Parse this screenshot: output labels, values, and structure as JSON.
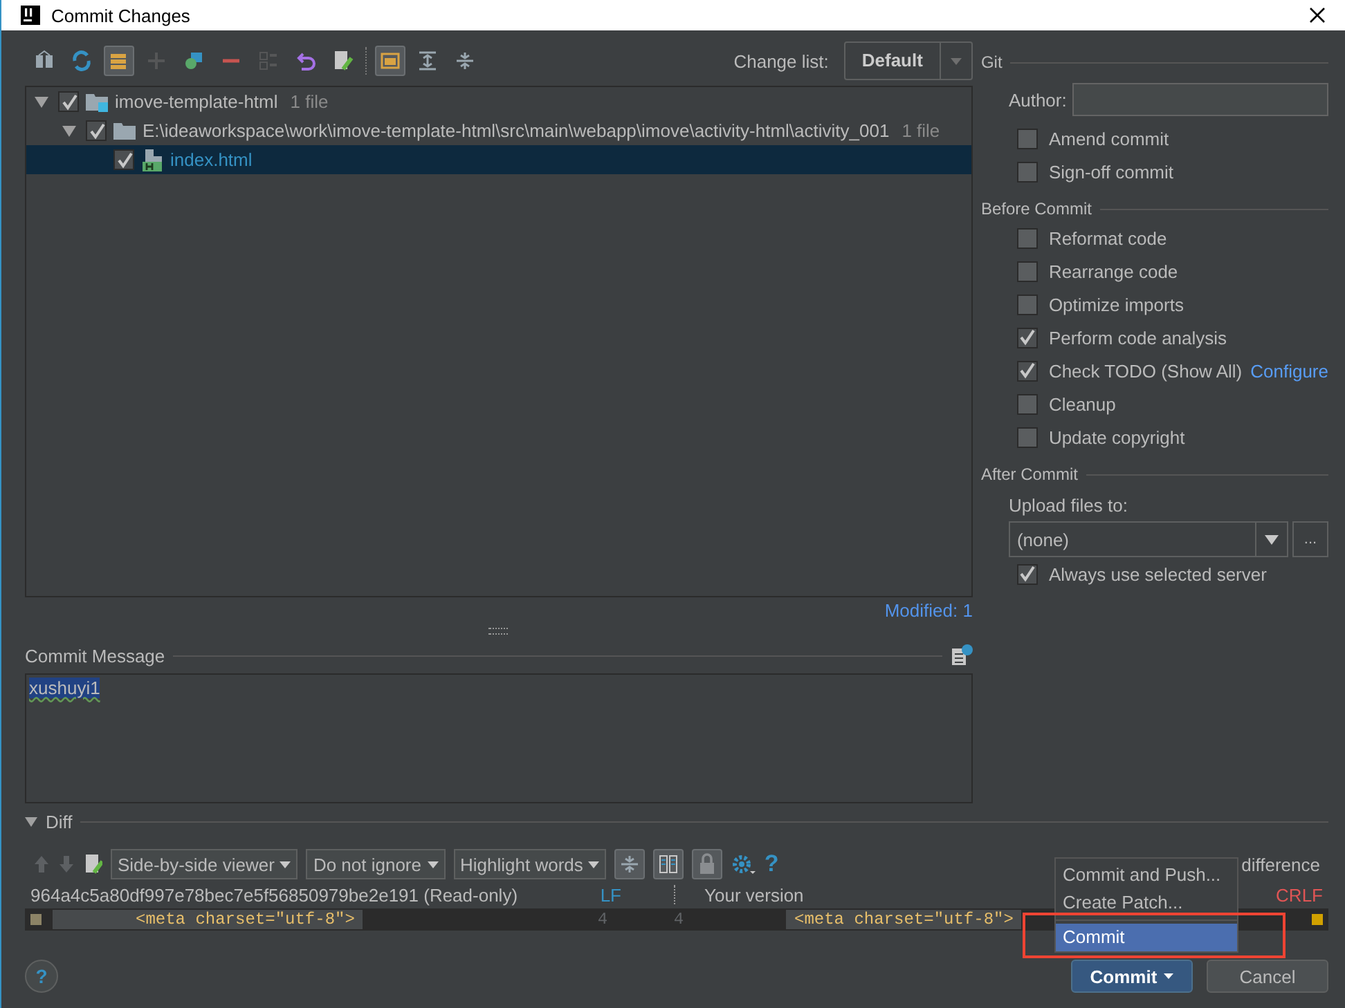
{
  "window": {
    "title": "Commit Changes"
  },
  "toolbar": [
    {
      "kind": "diff",
      "pressed": false,
      "disabled": false
    },
    {
      "kind": "refresh",
      "pressed": false,
      "disabled": false
    },
    {
      "kind": "group",
      "pressed": true,
      "disabled": false
    },
    {
      "kind": "add",
      "pressed": false,
      "disabled": true
    },
    {
      "kind": "move",
      "pressed": false,
      "disabled": false
    },
    {
      "kind": "remove",
      "pressed": false,
      "disabled": false
    },
    {
      "kind": "list",
      "pressed": false,
      "disabled": true
    },
    {
      "kind": "undo",
      "pressed": false,
      "disabled": false
    },
    {
      "kind": "edit",
      "pressed": false,
      "disabled": false
    },
    {
      "kind": "folder",
      "pressed": true,
      "disabled": false
    },
    {
      "kind": "expand",
      "pressed": false,
      "disabled": false
    },
    {
      "kind": "collapse",
      "pressed": false,
      "disabled": false
    }
  ],
  "change_list": {
    "label": "Change list:",
    "value": "Default"
  },
  "tree": [
    {
      "kind": "module",
      "label": "imove-template-html",
      "count": "1 file",
      "checked": true,
      "expanded": true,
      "selected": false,
      "children": [
        {
          "kind": "folder",
          "label": "E:\\ideaworkspace\\work\\imove-template-html\\src\\main\\webapp\\imove\\activity-html\\activity_001",
          "count": "1 file",
          "checked": true,
          "expanded": true,
          "selected": false,
          "children": [
            {
              "kind": "file",
              "label": "index.html",
              "checked": true,
              "selected": true
            }
          ]
        }
      ]
    }
  ],
  "modified": "Modified: 1",
  "commit_message": {
    "label": "Commit Message",
    "value": "xushuyi1"
  },
  "help": "?",
  "diff": {
    "label": "Diff",
    "help": "?",
    "expanded": true,
    "viewer": "Side-by-side viewer",
    "ignore": "Do not ignore",
    "highlight": "Highlight words",
    "difference": "difference",
    "left_title": "964a4c5a80df997e78bec7e5f56850979be2e191 (Read-only)",
    "left_eol": "LF",
    "right_title": "Your version",
    "right_eol": "CRLF",
    "left_line": "<meta charset=\"utf-8\">",
    "left_number": "4",
    "right_number": "4",
    "right_line": "<meta charset=\"utf-8\">"
  },
  "git": {
    "label": "Git",
    "author_label": "Author:",
    "options": [
      {
        "label": "Amend commit",
        "checked": false
      },
      {
        "label": "Sign-off commit",
        "checked": false
      }
    ]
  },
  "before_commit": {
    "label": "Before Commit",
    "options": [
      {
        "label": "Reformat code",
        "checked": false
      },
      {
        "label": "Rearrange code",
        "checked": false
      },
      {
        "label": "Optimize imports",
        "checked": false
      },
      {
        "label": "Perform code analysis",
        "checked": true
      },
      {
        "label": "Check TODO (Show All)",
        "checked": true,
        "link": "Configure"
      },
      {
        "label": "Cleanup",
        "checked": false
      },
      {
        "label": "Update copyright",
        "checked": false
      }
    ]
  },
  "after_commit": {
    "label": "After Commit",
    "upload_label": "Upload files to:",
    "upload_value": "(none)",
    "more": "...",
    "always": {
      "label": "Always use selected server",
      "checked": true
    }
  },
  "popup_menu": [
    {
      "label": "Commit and Push...",
      "selected": false
    },
    {
      "label": "Create Patch...",
      "selected": false
    },
    {
      "label": "Commit",
      "selected": true
    }
  ],
  "buttons": [
    {
      "kind": "split",
      "label": "Commit",
      "default": true
    },
    {
      "kind": "plain",
      "label": "Cancel",
      "default": false
    }
  ]
}
